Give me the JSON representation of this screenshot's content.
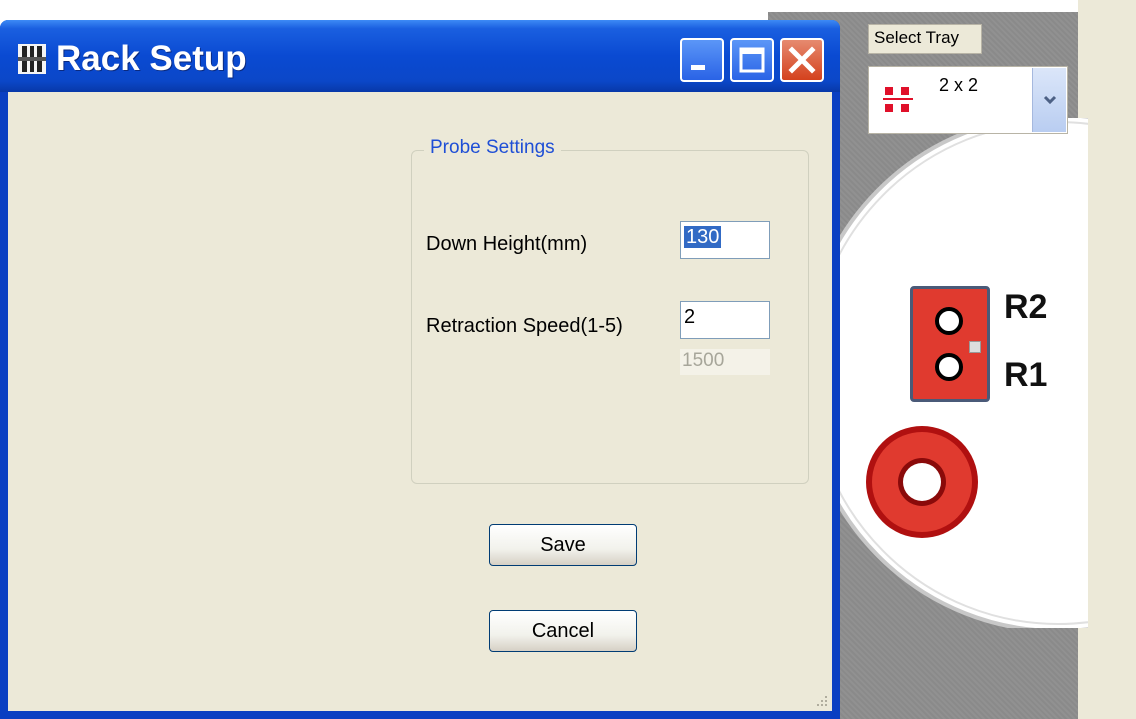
{
  "window": {
    "title": "Rack Setup"
  },
  "probe_settings": {
    "group_title": "Probe Settings",
    "down_height_label": "Down Height(mm)",
    "down_height_value": "130",
    "retraction_speed_label": "Retraction Speed(1-5)",
    "retraction_speed_value": "2",
    "retraction_speed_display": "1500"
  },
  "buttons": {
    "save": "Save",
    "cancel": "Cancel"
  },
  "tray": {
    "label": "Select Tray",
    "selected": "2 x 2",
    "rack_labels": [
      "R2",
      "R1"
    ]
  },
  "colors": {
    "titlebar": "#0a4ad2",
    "dialog_bg": "#ece9d8",
    "group_title": "#1f4fd6",
    "rack_red": "#e03a2f"
  }
}
